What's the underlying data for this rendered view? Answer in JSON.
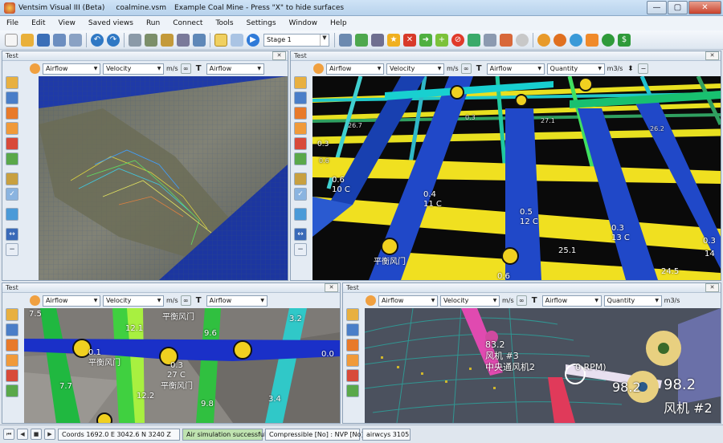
{
  "window": {
    "title": "Ventsim Visual III (Beta)",
    "file": "coalmine.vsm",
    "subtitle": "Example Coal Mine - Press \"X\" to hide surfaces",
    "min": "—",
    "max": "▢",
    "close": "✕"
  },
  "menu": [
    "File",
    "Edit",
    "View",
    "Saved views",
    "Run",
    "Connect",
    "Tools",
    "Settings",
    "Window",
    "Help"
  ],
  "toolbar": {
    "stage": "Stage 1"
  },
  "panes": {
    "top_left": {
      "title": "Test",
      "c1": "Airflow",
      "c2": "Velocity",
      "unit": "m/s",
      "c3": "Airflow"
    },
    "top_right": {
      "title": "Test",
      "c1": "Airflow",
      "c2": "Velocity",
      "unit": "m/s",
      "c3": "Airflow",
      "c4": "Quantity",
      "unit2": "m3/s"
    },
    "bottom_left": {
      "title": "Test",
      "c1": "Airflow",
      "c2": "Velocity",
      "unit": "m/s",
      "c3": "Airflow"
    },
    "bottom_right": {
      "title": "Test",
      "c1": "Airflow",
      "c2": "Velocity",
      "unit": "m/s",
      "c3": "Airflow",
      "c4": "Quantity",
      "unit2": "m3/s"
    }
  },
  "tr_labels": {
    "a": "0.3",
    "b": "0.6",
    "c": "10 C",
    "d": "0.4",
    "e": "11 C",
    "f": "0.5",
    "g": "12 C",
    "h": "0.3",
    "i": "13 C",
    "j": "0.3",
    "k": "14",
    "l": "25.1",
    "m": "24.5",
    "n": "0.6",
    "o": "平衡风门",
    "p": "26.7",
    "q": "0.3",
    "r": "27.1",
    "s": "26.2",
    "t": "0.6"
  },
  "bl_labels": {
    "a": "7.5",
    "b": "12.1",
    "c": "平衡风门",
    "d": "9.6",
    "e": "3.2",
    "f": "0.1",
    "g": "平衡风门",
    "h": "0.3",
    "i": "27 C",
    "j": "平衡风门",
    "k": "0.0",
    "l": "7.7",
    "m": "12.2",
    "n": "9.8",
    "o": "3.4"
  },
  "br_labels": {
    "a": "83.2",
    "b": "风机 #3",
    "c": "中央通风机2",
    "d": "0 RPM)",
    "e": "98.2",
    "f": "98.2",
    "g": "风机 #2"
  },
  "status": {
    "coords": "Coords 1692.0 E   3042.6 N   3240 Z",
    "sim": "Air simulation successful",
    "comp": "Compressible [No] : NVP [No]",
    "ways": "airwcys 3105"
  }
}
